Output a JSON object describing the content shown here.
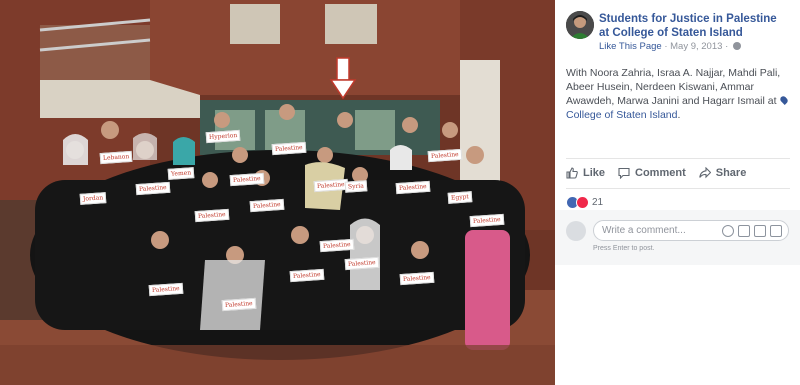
{
  "post": {
    "page_name": "Students for Justice in Palestine at College of Staten Island",
    "like_page": "Like This Page",
    "separator": "·",
    "date": "May 9, 2013",
    "caption_prefix": "With ",
    "tagged": [
      "Noora Zahria",
      "Israa A. Najjar",
      "Mahdi Pali",
      "Abeer Husein",
      "Nerdeen Kiswani",
      "Ammar Awawdeh",
      "Marwa Janini"
    ],
    "and_word": " and ",
    "last_tagged": "Hagarr Ismail",
    "at_word": " at ",
    "location": "College of Staten Island",
    "period": "."
  },
  "actions": {
    "like": "Like",
    "comment": "Comment",
    "share": "Share"
  },
  "reactions": {
    "count": "21"
  },
  "comment_box": {
    "placeholder": "Write a comment...",
    "hint": "Press Enter to post."
  },
  "photo": {
    "signs": [
      "Hyperion",
      "Palestine",
      "Lebanon",
      "Yemen",
      "Palestine",
      "Palestine",
      "Palestine",
      "Syria",
      "Palestine",
      "Palestine",
      "Egypt",
      "Jordan",
      "Palestine",
      "Palestine",
      "Palestine",
      "Palestine",
      "Palestine",
      "Palestine",
      "Palestine",
      "Palestine",
      "Palestine"
    ],
    "colors": {
      "brick": "#7a3a2a",
      "arrow": "#ffffff",
      "sign_text": "#c0392b"
    }
  }
}
